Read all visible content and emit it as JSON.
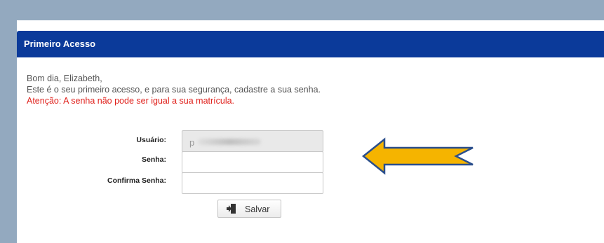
{
  "header": {
    "title": "Primeiro Acesso"
  },
  "message": {
    "greeting": "Bom dia, Elizabeth,",
    "info": "Este é o seu primeiro acesso, e para sua segurança, cadastre a sua senha.",
    "warning": "Atenção: A senha não pode ser igual a sua matrícula."
  },
  "form": {
    "username_label": "Usuário:",
    "username_value": "p",
    "password_label": "Senha:",
    "password_value": "",
    "confirm_label": "Confirma Senha:",
    "confirm_value": "",
    "save_label": "Salvar"
  },
  "icons": {
    "save": "sign-in-icon",
    "annotation": "left-arrow-icon"
  },
  "colors": {
    "header_bg": "#0b3a9a",
    "warning_text": "#e0211c",
    "arrow_fill": "#f5b400",
    "arrow_stroke": "#2b4f8c",
    "page_bg": "#93a9bf"
  }
}
